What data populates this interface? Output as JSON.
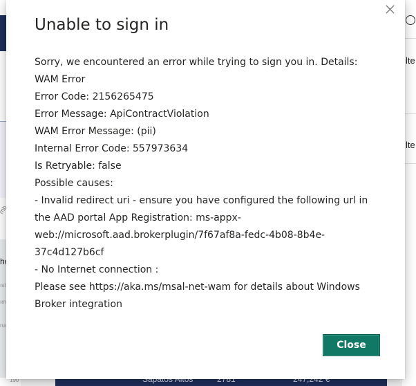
{
  "background": {
    "left_text": "ho",
    "left_rotated_label": "mb",
    "left_small_labels": [
      "ıst",
      "ım",
      "ruc"
    ],
    "left_number": "190",
    "right_labels": [
      "lte",
      "lte"
    ],
    "bottom_row": {
      "name": "Sapatos Altos",
      "qty": "2781",
      "amount": "247,242 €"
    }
  },
  "dialog": {
    "title": "Unable to sign in",
    "lines": [
      "Sorry, we encountered an error while trying to sign you in. Details:",
      "WAM Error",
      "Error Code: 2156265475",
      "Error Message: ApiContractViolation",
      "WAM Error Message: (pii)",
      "Internal Error Code: 557973634",
      "Is Retryable: false",
      "Possible causes:",
      "- Invalid redirect uri - ensure you have configured the following url in",
      "the AAD portal App Registration: ms-appx-",
      "web://microsoft.aad.brokerplugin/7f67af8a-fedc-4b08-8b4e-",
      "37c4d127b6cf",
      "- No Internet connection :",
      "Please see https://aka.ms/msal-net-wam for details about Windows",
      "Broker integration"
    ],
    "close_button_label": "Close",
    "close_icon": "close-icon",
    "accent_color": "#117865"
  }
}
